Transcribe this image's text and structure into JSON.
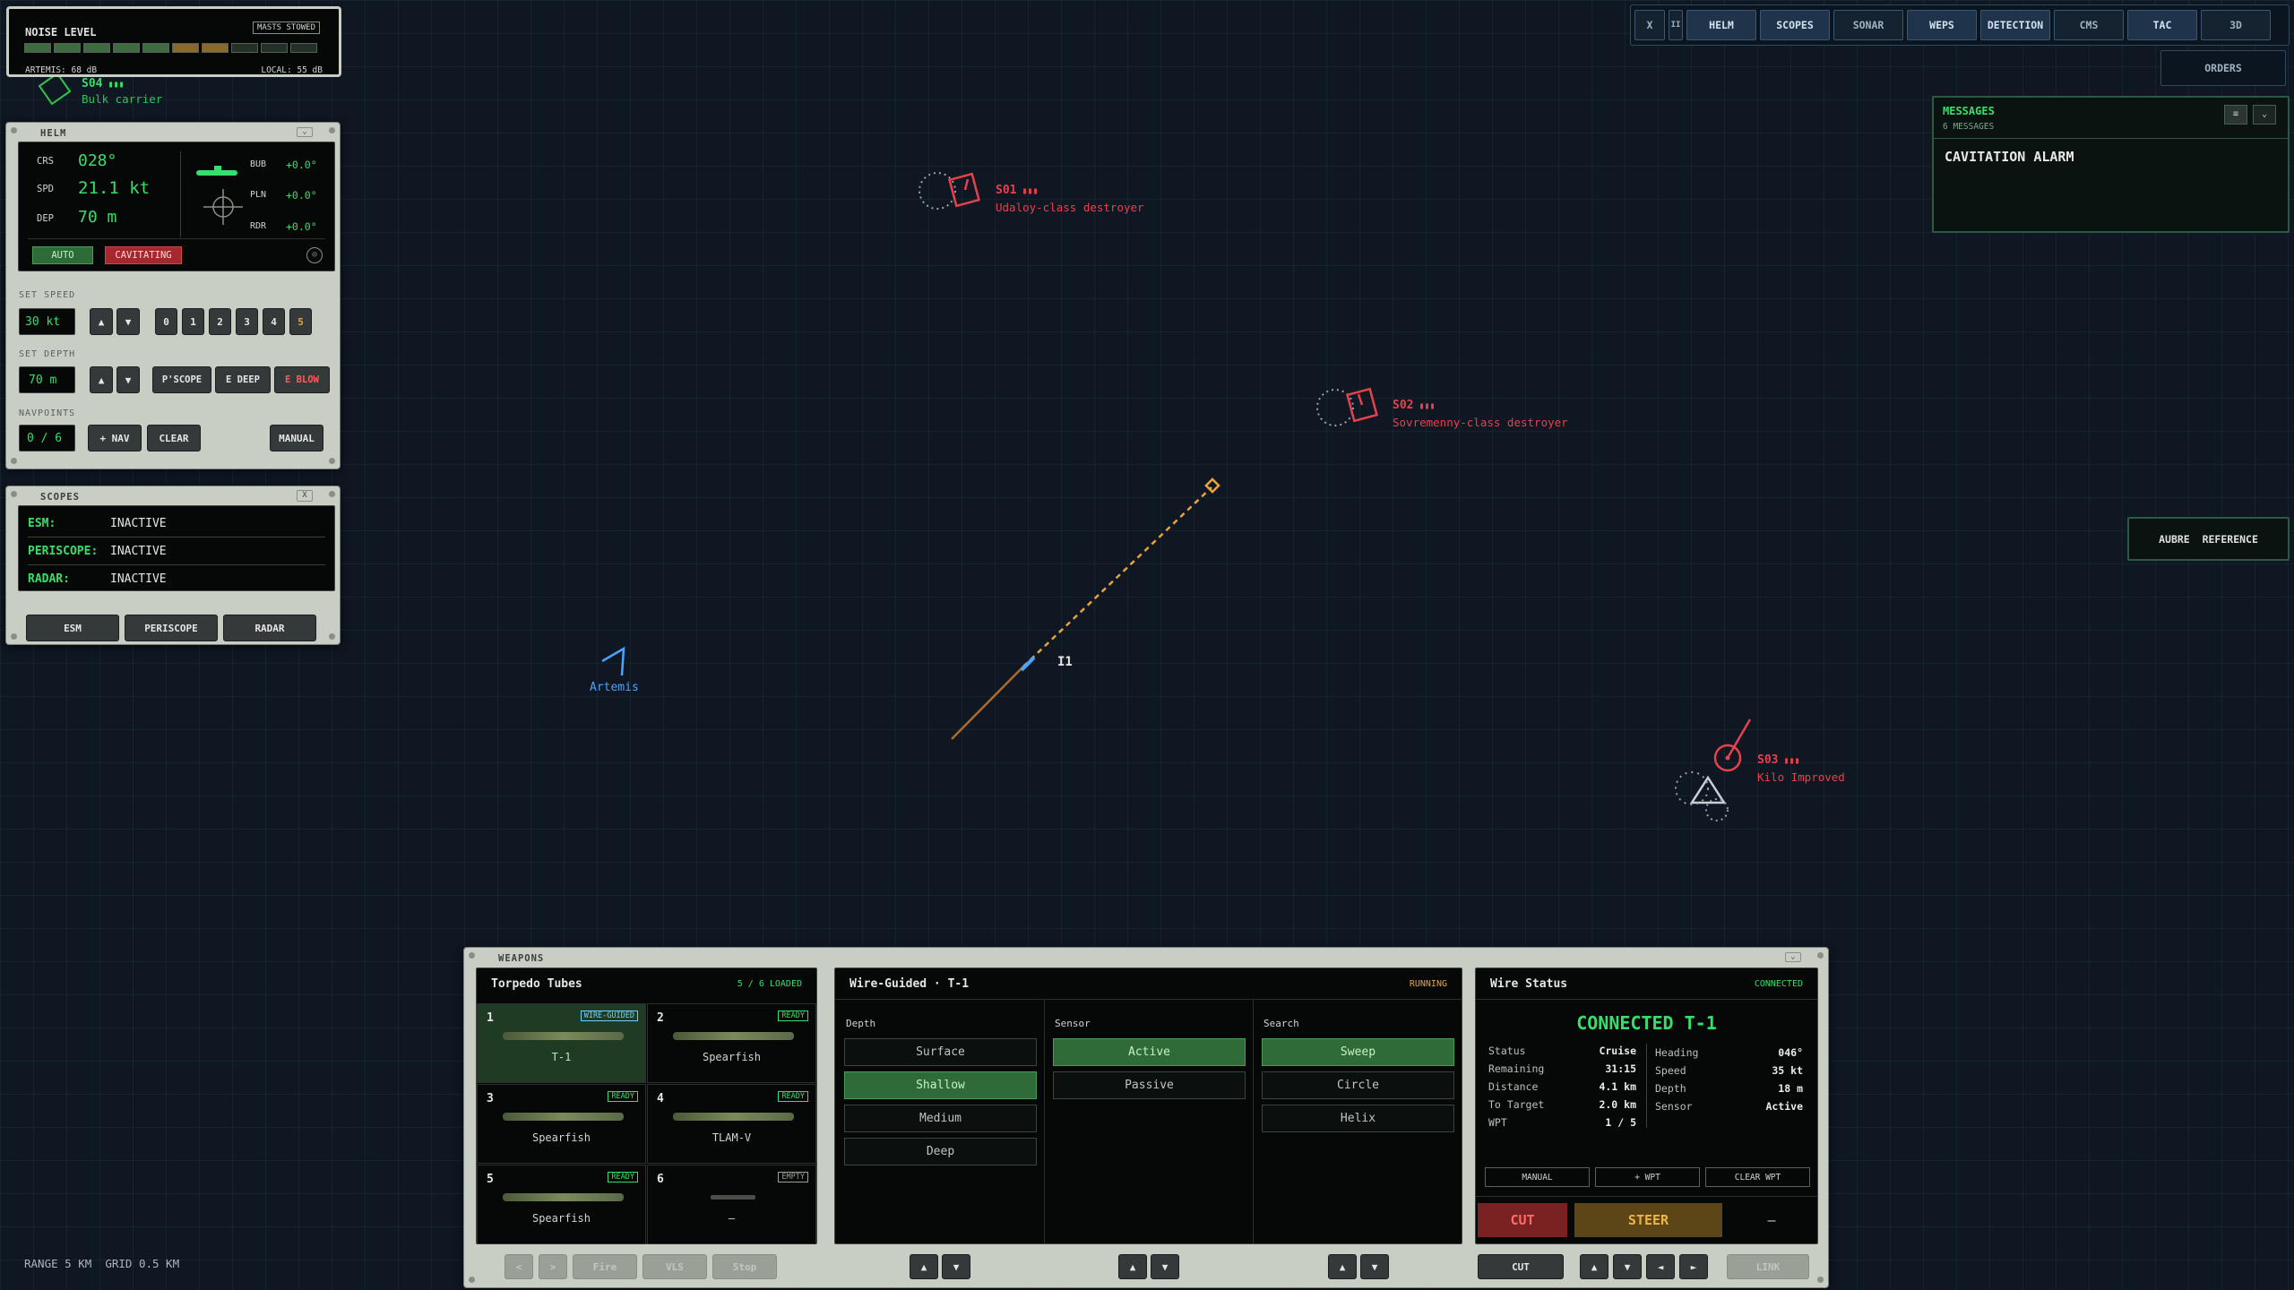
{
  "noise": {
    "title": "NOISE LEVEL",
    "badge": "MASTS STOWED",
    "artemis": "ARTEMIS: 68 dB",
    "local": "LOCAL: 55 dB",
    "level_segments": 7,
    "total_segments": 10
  },
  "contacts": {
    "s04": {
      "id": "S04",
      "type": "Bulk carrier"
    },
    "s01": {
      "id": "S01",
      "type": "Udaloy-class destroyer"
    },
    "s02": {
      "id": "S02",
      "type": "Sovremenny-class destroyer"
    },
    "s03": {
      "id": "S03",
      "type": "Kilo Improved"
    },
    "own": {
      "name": "Artemis"
    },
    "torpedo": {
      "id": "I1"
    }
  },
  "helm": {
    "title": "HELM",
    "crs_label": "CRS",
    "crs": "028°",
    "spd_label": "SPD",
    "spd": "21.1 kt",
    "dep_label": "DEP",
    "dep": "70 m",
    "bub_label": "BUB",
    "bub": "+0.0°",
    "pln_label": "PLN",
    "pln": "+0.0°",
    "rdr_label": "RDR",
    "rdr": "+0.0°",
    "auto": "AUTO",
    "cavitating": "CAVITATING",
    "set_speed_label": "SET SPEED",
    "set_speed": "30 kt",
    "speed_steps": [
      "0",
      "1",
      "2",
      "3",
      "4",
      "5"
    ],
    "set_depth_label": "SET DEPTH",
    "set_depth": "70 m",
    "pscope": "P'SCOPE",
    "edeep": "E DEEP",
    "eblow": "E BLOW",
    "navpoints_label": "NAVPOINTS",
    "navpoints": "0 / 6",
    "add_nav": "+ NAV",
    "clear": "CLEAR",
    "manual": "MANUAL",
    "up": "▲",
    "down": "▼"
  },
  "scopes": {
    "title": "SCOPES",
    "close": "X",
    "rows": [
      {
        "label": "ESM:",
        "value": "INACTIVE"
      },
      {
        "label": "PERISCOPE:",
        "value": "INACTIVE"
      },
      {
        "label": "RADAR:",
        "value": "INACTIVE"
      }
    ],
    "buttons": [
      "ESM",
      "PERISCOPE",
      "RADAR"
    ]
  },
  "topbar": {
    "close": "X",
    "pause": "II",
    "tabs": [
      "HELM",
      "SCOPES",
      "SONAR",
      "WEPS",
      "DETECTION",
      "CMS",
      "TAC",
      "3D"
    ]
  },
  "orders": "ORDERS",
  "messages": {
    "title": "MESSAGES",
    "count": "6 MESSAGES",
    "body": "CAVITATION ALARM"
  },
  "reference": "AUBRE  REFERENCE",
  "map": {
    "range": "RANGE 5 KM",
    "grid": "GRID 0.5 KM"
  },
  "weapons": {
    "title": "WEAPONS",
    "tubes_title": "Torpedo Tubes",
    "loaded": "5 / 6 LOADED",
    "tubes": [
      {
        "num": "1",
        "status": "WIRE-GUIDED",
        "name": "T-1"
      },
      {
        "num": "2",
        "status": "READY",
        "name": "Spearfish"
      },
      {
        "num": "3",
        "status": "READY",
        "name": "Spearfish"
      },
      {
        "num": "4",
        "status": "READY",
        "name": "TLAM-V"
      },
      {
        "num": "5",
        "status": "READY",
        "name": "Spearfish"
      },
      {
        "num": "6",
        "status": "EMPTY",
        "name": "—"
      }
    ],
    "bottom_buttons": [
      "<",
      ">",
      "Fire",
      "VLS",
      "Stop"
    ],
    "wire_title": "Wire-Guided · T-1",
    "wire_status": "RUNNING",
    "depth_label": "Depth",
    "depth_opts": [
      "Surface",
      "Shallow",
      "Medium",
      "Deep"
    ],
    "sensor_label": "Sensor",
    "sensor_opts": [
      "Active",
      "Passive"
    ],
    "search_label": "Search",
    "search_opts": [
      "Sweep",
      "Circle",
      "Helix"
    ],
    "ws_title": "Wire Status",
    "ws_state": "CONNECTED",
    "ws_big": "CONNECTED T-1",
    "left_stats": [
      {
        "k": "Status",
        "v": "Cruise"
      },
      {
        "k": "Remaining",
        "v": "31:15"
      },
      {
        "k": "Distance",
        "v": "4.1 km"
      },
      {
        "k": "To Target",
        "v": "2.0 km"
      },
      {
        "k": "WPT",
        "v": "1 / 5"
      }
    ],
    "right_stats": [
      {
        "k": "Heading",
        "v": "046°"
      },
      {
        "k": "Speed",
        "v": "35 kt"
      },
      {
        "k": "Depth",
        "v": "18 m"
      },
      {
        "k": "Sensor",
        "v": "Active"
      }
    ],
    "ws_manual": "MANUAL",
    "ws_addwpt": "+ WPT",
    "ws_clearwpt": "CLEAR WPT",
    "cut": "CUT",
    "steer": "STEER",
    "dash": "—",
    "cut2": "CUT",
    "arrows": [
      "▲",
      "▼",
      "◄",
      "►"
    ],
    "link": "LINK"
  },
  "colors": {
    "friendly": "#4aa3ff",
    "hostile": "#e8414c",
    "neutral": "#35c24a",
    "wire": "#e8a33c",
    "accent_green": "#35e06a"
  }
}
